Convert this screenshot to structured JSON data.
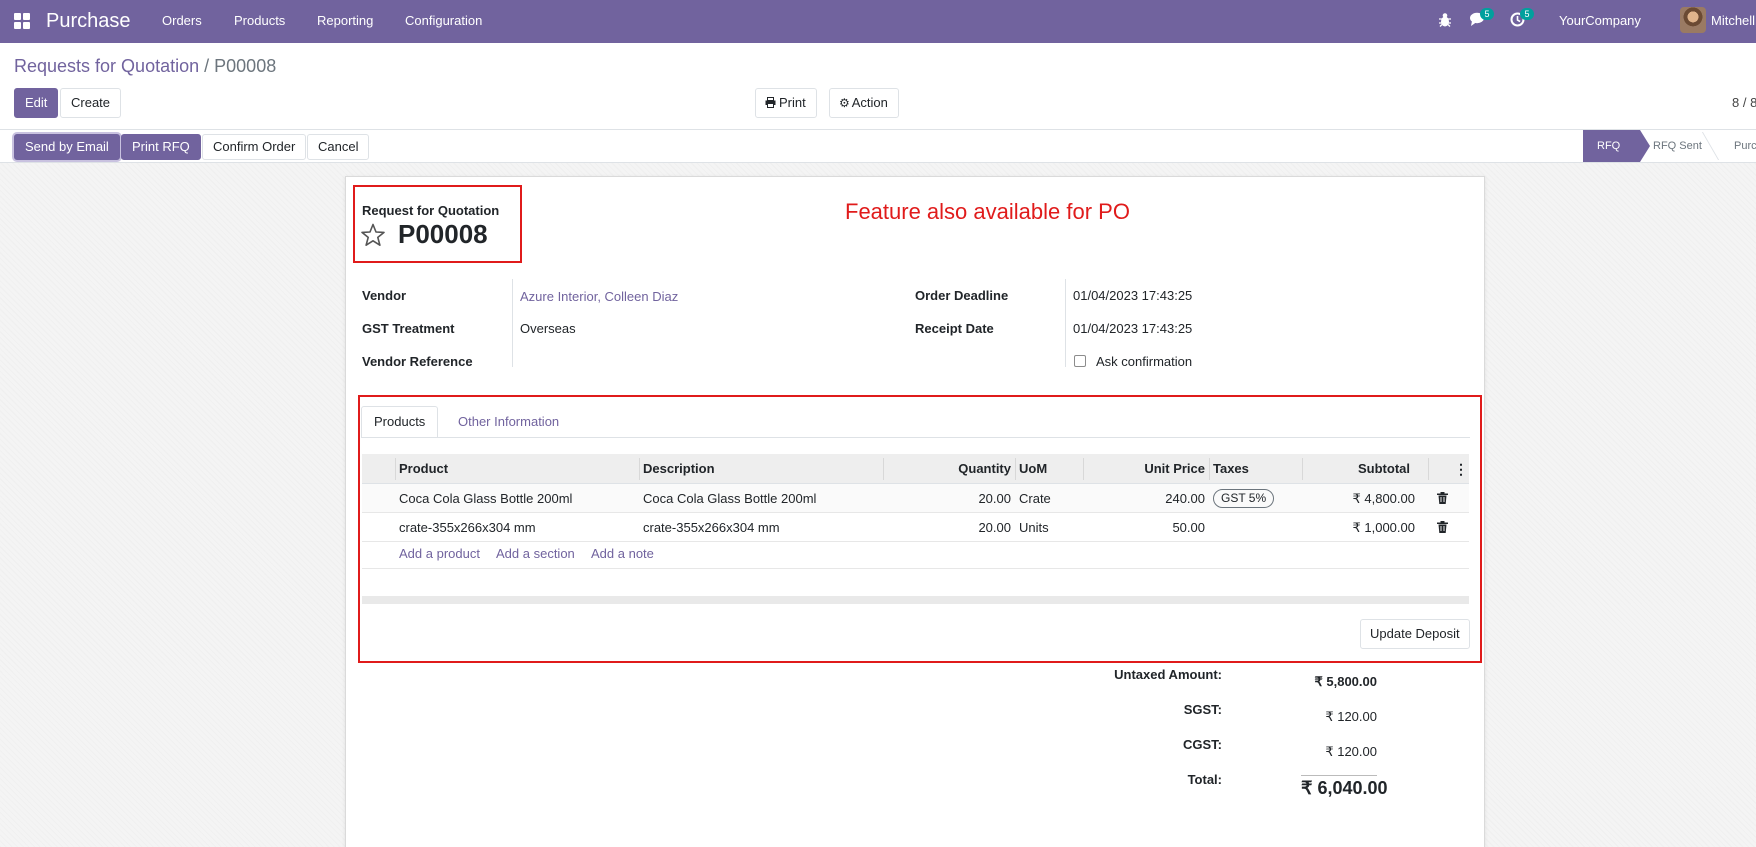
{
  "navbar": {
    "brand": "Purchase",
    "menu": [
      "Orders",
      "Products",
      "Reporting",
      "Configuration"
    ],
    "icons": [
      "apps-icon",
      "bug-icon",
      "chat-icon",
      "activity-icon"
    ],
    "messages_badge": "5",
    "activities_badge": "5",
    "company": "YourCompany",
    "user": "Mitchell"
  },
  "breadcrumb": {
    "parent": "Requests for Quotation",
    "separator": "/",
    "current": "P00008"
  },
  "toolbar": {
    "edit": "Edit",
    "create": "Create",
    "print": "Print",
    "action": "Action",
    "pager": "8 / 8"
  },
  "statusbar": {
    "buttons": [
      "Send by Email",
      "Print RFQ",
      "Confirm Order",
      "Cancel"
    ],
    "stages": [
      "RFQ",
      "RFQ Sent",
      "Purchase Order"
    ],
    "active_stage": "RFQ"
  },
  "form": {
    "title_label": "Request for Quotation",
    "title": "P00008",
    "annotation": "Feature also available for PO",
    "vendor_label": "Vendor",
    "vendor": "Azure Interior, Colleen Diaz",
    "gst_label": "GST Treatment",
    "gst": "Overseas",
    "vendor_ref_label": "Vendor Reference",
    "vendor_ref": "",
    "deadline_label": "Order Deadline",
    "deadline": "01/04/2023 17:43:25",
    "receipt_label": "Receipt Date",
    "receipt": "01/04/2023 17:43:25",
    "ask_confirmation": "Ask confirmation",
    "ask_confirmation_checked": false
  },
  "tabs": [
    "Products",
    "Other Information"
  ],
  "lines": {
    "columns": [
      "Product",
      "Description",
      "Quantity",
      "UoM",
      "Unit Price",
      "Taxes",
      "Subtotal"
    ],
    "rows": [
      {
        "product": "Coca Cola Glass Bottle 200ml",
        "description": "Coca Cola Glass Bottle 200ml",
        "quantity": "20.00",
        "uom": "Crate",
        "unit_price": "240.00",
        "taxes": "GST 5%",
        "subtotal": "₹ 4,800.00"
      },
      {
        "product": "crate-355x266x304 mm",
        "description": "crate-355x266x304 mm",
        "quantity": "20.00",
        "uom": "Units",
        "unit_price": "50.00",
        "taxes": "",
        "subtotal": "₹ 1,000.00"
      }
    ],
    "add_product": "Add a product",
    "add_section": "Add a section",
    "add_note": "Add a note"
  },
  "update_deposit": "Update Deposit",
  "totals": {
    "untaxed_label": "Untaxed Amount:",
    "untaxed": "₹ 5,800.00",
    "sgst_label": "SGST:",
    "sgst": "₹ 120.00",
    "cgst_label": "CGST:",
    "cgst": "₹ 120.00",
    "total_label": "Total:",
    "total": "₹ 6,040.00"
  },
  "colors": {
    "brand": "#71639e",
    "annotation": "#e01b1b",
    "badge": "#00a09d"
  }
}
